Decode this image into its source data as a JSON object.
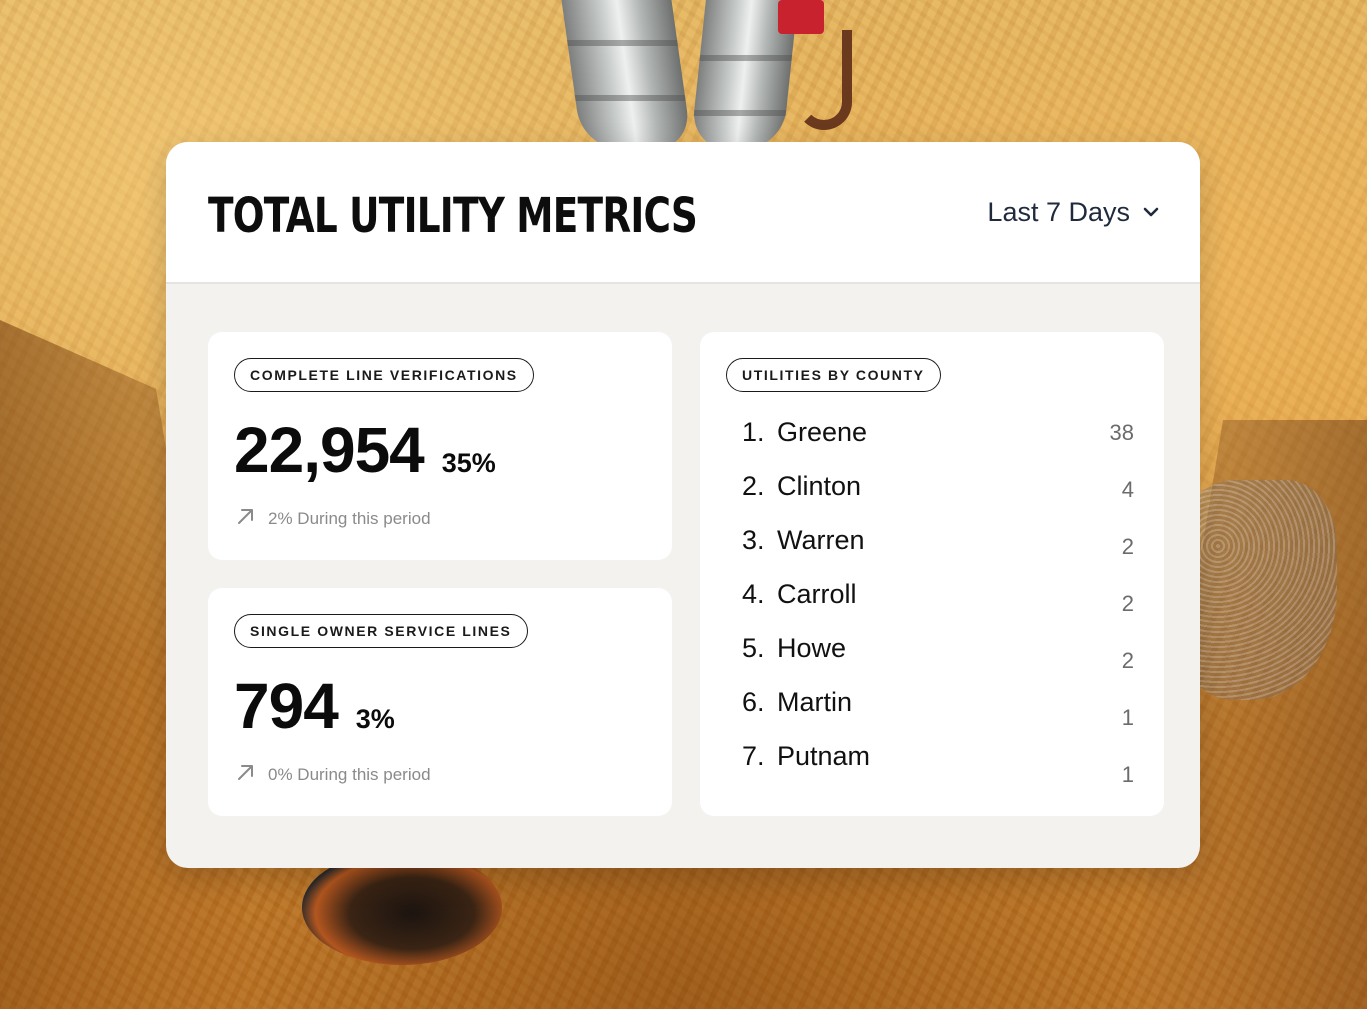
{
  "header": {
    "title": "TOTAL UTILITY METRICS",
    "period": {
      "selected": "Last 7 Days",
      "icon": "chevron-down-icon"
    }
  },
  "metrics": [
    {
      "label": "COMPLETE LINE VERIFICATIONS",
      "value": "22,954",
      "percent": "35%",
      "trend_icon": "arrow-up-right-icon",
      "trend_text": "2% During this period"
    },
    {
      "label": "SINGLE OWNER SERVICE LINES",
      "value": "794",
      "percent": "3%",
      "trend_icon": "arrow-up-right-icon",
      "trend_text": "0% During this period"
    }
  ],
  "counties": {
    "label": "UTILITIES BY COUNTY",
    "items": [
      {
        "rank": "1.",
        "name": "Greene",
        "count": "38"
      },
      {
        "rank": "2.",
        "name": "Clinton",
        "count": "4"
      },
      {
        "rank": "3.",
        "name": "Warren",
        "count": "2"
      },
      {
        "rank": "4.",
        "name": "Carroll",
        "count": "2"
      },
      {
        "rank": "5.",
        "name": "Howe",
        "count": "2"
      },
      {
        "rank": "6.",
        "name": "Martin",
        "count": "1"
      },
      {
        "rank": "7.",
        "name": "Putnam",
        "count": "1"
      }
    ]
  },
  "colors": {
    "card_background": "#f3f2ef",
    "panel_background": "#ffffff",
    "text_primary": "#0b0b0b",
    "text_muted": "#8a8a8a",
    "dropdown_text": "#1f2a3c"
  }
}
